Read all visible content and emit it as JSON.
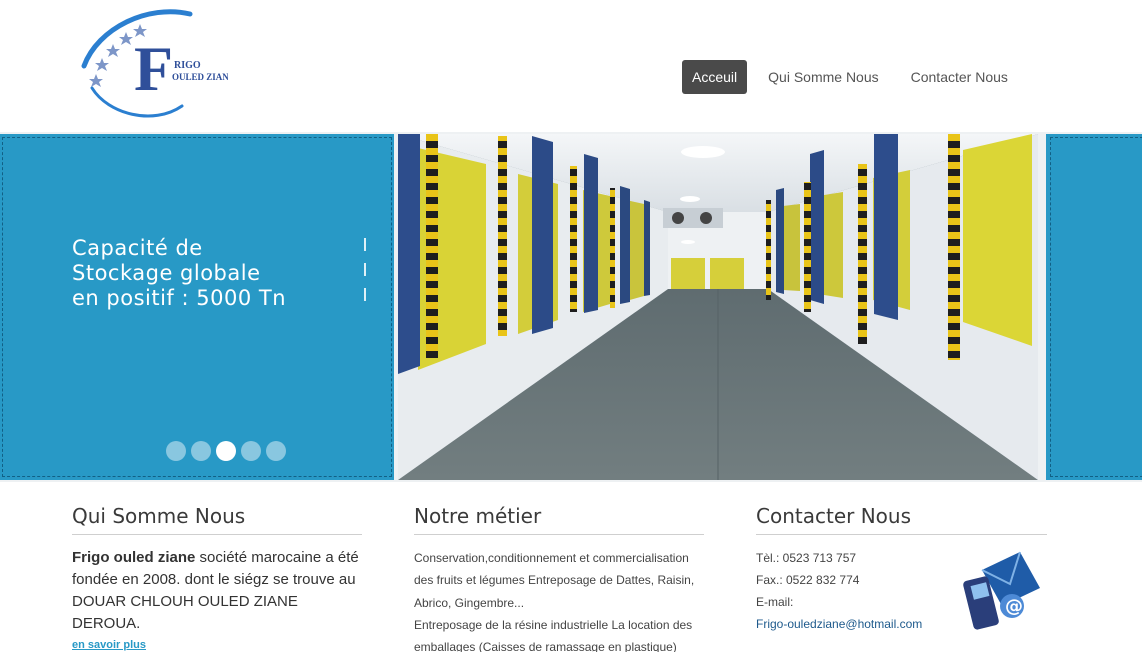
{
  "brand": {
    "logo_text_line1": "RIGO",
    "logo_text_line2": "OULED ZIANE",
    "logo_letter": "F",
    "accent_color": "#2899c6",
    "logo_color": "#2f4f9a"
  },
  "nav": {
    "items": [
      {
        "label": "Acceuil",
        "active": true
      },
      {
        "label": "Qui Somme Nous",
        "active": false
      },
      {
        "label": "Contacter Nous",
        "active": false
      }
    ]
  },
  "slider": {
    "text_lines": [
      "Capacité de",
      "Stockage globale",
      "en positif : 5000 Tn"
    ],
    "dots_count": 5,
    "active_dot": 3
  },
  "about": {
    "title": "Qui Somme Nous",
    "company_name": "Frigo ouled ziane",
    "description": "société marocaine a été fondée en 2008. dont le siégz se trouve au DOUAR CHLOUH OULED ZIANE DEROUA.",
    "link": "en savoir plus"
  },
  "metier": {
    "title": "Notre métier",
    "text": "Conservation,conditionnement et commercialisation des fruits et légumes Entreposage de Dattes, Raisin, Abrico, Gingembre...",
    "text2": "Entreposage de la résine industrielle La location des emballages (Caisses de ramassage en plastique)"
  },
  "contact": {
    "title": "Contacter Nous",
    "tel": "Tèl.: 0523 713 757",
    "fax": "Fax.: 0522 832 774",
    "email_label": "E-mail:",
    "email": "Frigo-ouledziane@hotmail.com"
  }
}
